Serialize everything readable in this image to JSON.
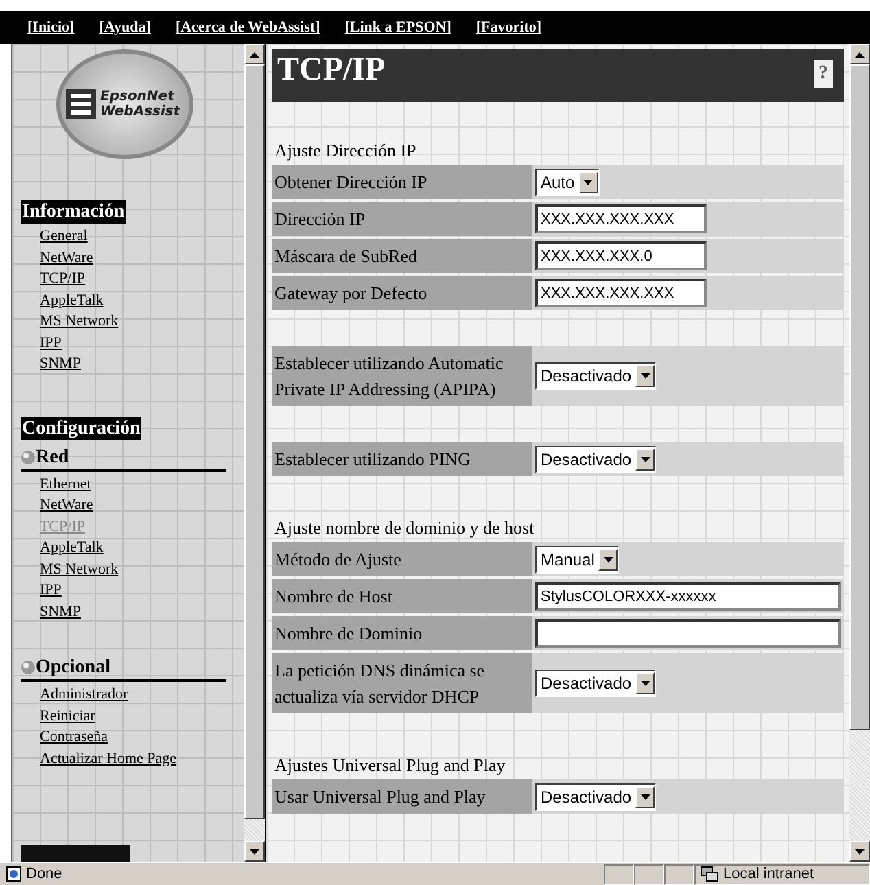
{
  "top_links": [
    "[Inicio]",
    "[Ayuda]",
    "[Acerca de WebAssist]",
    "[Link a EPSON]",
    "[Favorito]"
  ],
  "logo": {
    "line1": "EpsonNet",
    "line2": "WebAssist"
  },
  "sidebar": [
    {
      "title": "Información",
      "kind": "inverse",
      "items": [
        {
          "label": "General",
          "selected": false
        },
        {
          "label": "NetWare",
          "selected": false
        },
        {
          "label": "TCP/IP",
          "selected": false
        },
        {
          "label": "AppleTalk",
          "selected": false
        },
        {
          "label": "MS Network",
          "selected": false
        },
        {
          "label": "IPP",
          "selected": false
        },
        {
          "label": "SNMP",
          "selected": false
        }
      ]
    },
    {
      "title": "Configuración",
      "kind": "inverse"
    },
    {
      "title": "Red",
      "kind": "bullet",
      "items": [
        {
          "label": "Ethernet",
          "selected": false
        },
        {
          "label": "NetWare",
          "selected": false
        },
        {
          "label": "TCP/IP",
          "selected": true
        },
        {
          "label": "AppleTalk",
          "selected": false
        },
        {
          "label": "MS Network",
          "selected": false
        },
        {
          "label": "IPP",
          "selected": false
        },
        {
          "label": "SNMP",
          "selected": false
        }
      ]
    },
    {
      "title": "Opcional",
      "kind": "bullet",
      "items": [
        {
          "label": "Administrador",
          "selected": false
        },
        {
          "label": "Reiniciar",
          "selected": false
        },
        {
          "label": "Contraseña",
          "selected": false
        },
        {
          "label": "Actualizar Home Page",
          "selected": false
        }
      ]
    }
  ],
  "main": {
    "title": "TCP/IP",
    "help": "?",
    "items": [
      {
        "kind": "gap"
      },
      {
        "kind": "heading",
        "text": "Ajuste Dirección IP"
      },
      {
        "kind": "select",
        "label": "Obtener Dirección IP",
        "value": "Auto"
      },
      {
        "kind": "input",
        "label": "Dirección IP",
        "value": "XXX.XXX.XXX.XXX"
      },
      {
        "kind": "input",
        "label": "Máscara de SubRed",
        "value": "XXX.XXX.XXX.0"
      },
      {
        "kind": "input",
        "label": "Gateway por Defecto",
        "value": "XXX.XXX.XXX.XXX"
      },
      {
        "kind": "gap"
      },
      {
        "kind": "select",
        "label": "Establecer utilizando Automatic Private IP Addressing (APIPA)",
        "value": "Desactivado"
      },
      {
        "kind": "gap"
      },
      {
        "kind": "select",
        "label": "Establecer utilizando PING",
        "value": "Desactivado"
      },
      {
        "kind": "gap"
      },
      {
        "kind": "heading",
        "text": "Ajuste nombre de dominio y de host"
      },
      {
        "kind": "select",
        "label": "Método de Ajuste",
        "value": "Manual"
      },
      {
        "kind": "wideinput",
        "label": "Nombre de Host",
        "value": "StylusCOLORXXX-xxxxxx"
      },
      {
        "kind": "wideinput",
        "label": "Nombre de Dominio",
        "value": ""
      },
      {
        "kind": "select",
        "label": "La petición DNS dinámica se actualiza vía servidor DHCP",
        "value": "Desactivado"
      },
      {
        "kind": "gap"
      },
      {
        "kind": "heading",
        "text": "Ajustes Universal Plug and Play"
      },
      {
        "kind": "select",
        "label": "Usar Universal Plug and Play",
        "value": "Desactivado"
      }
    ]
  },
  "status_bar": {
    "text": "Done",
    "zone": "Local intranet"
  }
}
